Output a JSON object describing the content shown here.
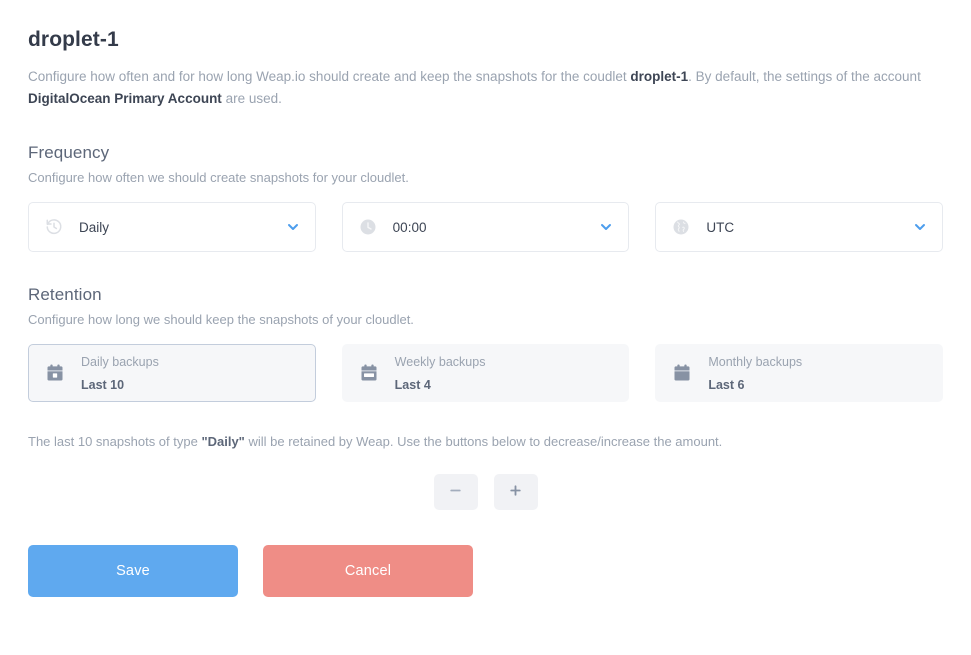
{
  "header": {
    "title": "droplet-1",
    "desc_part1": "Configure how often and for how long Weap.io should create and keep the snapshots for the coudlet ",
    "desc_coudlet": "droplet-1",
    "desc_part2": ". By default, the settings of the account ",
    "desc_account": "DigitalOcean Primary Account",
    "desc_part3": " are used."
  },
  "frequency": {
    "title": "Frequency",
    "desc": "Configure how often we should create snapshots for your cloudlet.",
    "selects": [
      {
        "icon": "history-icon",
        "value": "Daily",
        "chevron": "chevron-down-icon"
      },
      {
        "icon": "clock-icon",
        "value": "00:00",
        "chevron": "chevron-down-icon"
      },
      {
        "icon": "globe-icon",
        "value": "UTC",
        "chevron": "chevron-down-icon"
      }
    ]
  },
  "retention": {
    "title": "Retention",
    "desc": "Configure how long we should keep the snapshots of your cloudlet.",
    "cards": [
      {
        "icon": "calendar-day-icon",
        "label": "Daily backups",
        "amount": "Last 10",
        "selected": true
      },
      {
        "icon": "calendar-week-icon",
        "label": "Weekly backups",
        "amount": "Last 4",
        "selected": false
      },
      {
        "icon": "calendar-month-icon",
        "label": "Monthly backups",
        "amount": "Last 6",
        "selected": false
      }
    ],
    "note_part1": "The last 10 snapshots of type ",
    "note_type": "\"Daily\"",
    "note_part2": " will be retained by Weap. Use the buttons below to decrease/increase the amount.",
    "decrease_icon": "minus-icon",
    "increase_icon": "plus-icon"
  },
  "actions": {
    "save_label": "Save",
    "cancel_label": "Cancel"
  },
  "colors": {
    "accent_blue": "#5fa9ef",
    "cancel_red": "#ef8d86",
    "chevron_blue": "#4d9ded",
    "heading": "#5d6779",
    "title": "#343b4a",
    "muted": "#9aa3b0",
    "card_bg": "#f6f7f9",
    "card_selected_border": "#c3cddc"
  }
}
